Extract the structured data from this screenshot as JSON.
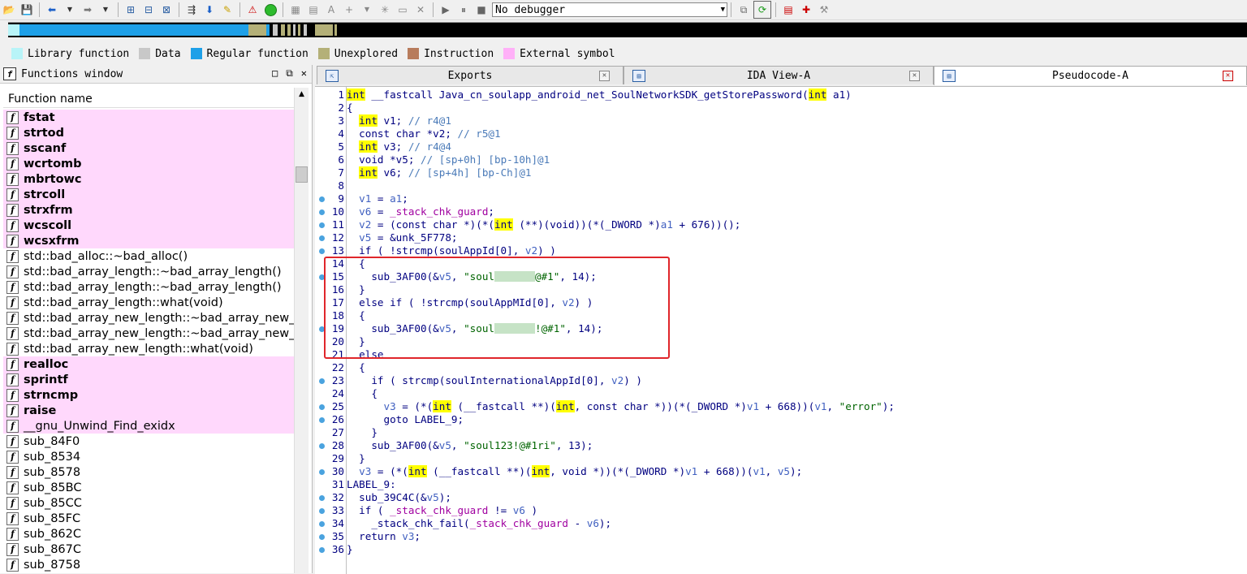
{
  "toolbar": {
    "debugger_select": "No debugger"
  },
  "legend": [
    {
      "label": "Library function",
      "color": "#b8f4f8"
    },
    {
      "label": "Data",
      "color": "#c8c8c8"
    },
    {
      "label": "Regular function",
      "color": "#1ea0e8"
    },
    {
      "label": "Unexplored",
      "color": "#b4b078"
    },
    {
      "label": "Instruction",
      "color": "#b87c5c"
    },
    {
      "label": "External symbol",
      "color": "#ffb0f8"
    }
  ],
  "functions_window": {
    "title": "Functions window",
    "column_header": "Function name",
    "rows": [
      {
        "name": "fstat",
        "lib": true
      },
      {
        "name": "strtod",
        "lib": true
      },
      {
        "name": "sscanf",
        "lib": true
      },
      {
        "name": "wcrtomb",
        "lib": true
      },
      {
        "name": "mbrtowc",
        "lib": true
      },
      {
        "name": "strcoll",
        "lib": true
      },
      {
        "name": "strxfrm",
        "lib": true
      },
      {
        "name": "wcscoll",
        "lib": true
      },
      {
        "name": "wcsxfrm",
        "lib": true
      },
      {
        "name": "std::bad_alloc::~bad_alloc()",
        "lib": false
      },
      {
        "name": "std::bad_array_length::~bad_array_length()",
        "lib": false
      },
      {
        "name": "std::bad_array_length::~bad_array_length()",
        "lib": false
      },
      {
        "name": "std::bad_array_length::what(void)",
        "lib": false
      },
      {
        "name": "std::bad_array_new_length::~bad_array_new_l",
        "lib": false
      },
      {
        "name": "std::bad_array_new_length::~bad_array_new_l",
        "lib": false
      },
      {
        "name": "std::bad_array_new_length::what(void)",
        "lib": false
      },
      {
        "name": "realloc",
        "lib": true
      },
      {
        "name": "sprintf",
        "lib": true
      },
      {
        "name": "strncmp",
        "lib": true
      },
      {
        "name": "raise",
        "lib": true
      },
      {
        "name": "__gnu_Unwind_Find_exidx",
        "lib": true,
        "light": true
      },
      {
        "name": "sub_84F0",
        "lib": false
      },
      {
        "name": "sub_8534",
        "lib": false
      },
      {
        "name": "sub_8578",
        "lib": false
      },
      {
        "name": "sub_85BC",
        "lib": false
      },
      {
        "name": "sub_85CC",
        "lib": false
      },
      {
        "name": "sub_85FC",
        "lib": false
      },
      {
        "name": "sub_862C",
        "lib": false
      },
      {
        "name": "sub_867C",
        "lib": false
      },
      {
        "name": "sub_8758",
        "lib": false
      }
    ]
  },
  "tabs": [
    {
      "label": "Exports",
      "active": false
    },
    {
      "label": "IDA View-A",
      "active": false
    },
    {
      "label": "Pseudocode-A",
      "active": true
    }
  ],
  "code": [
    {
      "n": "1",
      "dot": false,
      "html": "<span class=\"kw\">int</span> __fastcall Java_cn_soulapp_android_net_SoulNetworkSDK_getStorePassword(<span class=\"kw\">int</span> a1)"
    },
    {
      "n": "2",
      "dot": false,
      "html": "{"
    },
    {
      "n": "3",
      "dot": false,
      "html": "  <span class=\"kw\">int</span> v1; <span class=\"cm\">// r4@1</span>"
    },
    {
      "n": "4",
      "dot": false,
      "html": "  const char *v2; <span class=\"cm\">// r5@1</span>"
    },
    {
      "n": "5",
      "dot": false,
      "html": "  <span class=\"kw\">int</span> v3; <span class=\"cm\">// r4@4</span>"
    },
    {
      "n": "6",
      "dot": false,
      "html": "  void *v5; <span class=\"cm\">// [sp+0h] [bp-10h]@1</span>"
    },
    {
      "n": "7",
      "dot": false,
      "html": "  <span class=\"kw\">int</span> v6; <span class=\"cm\">// [sp+4h] [bp-Ch]@1</span>"
    },
    {
      "n": "8",
      "dot": false,
      "html": ""
    },
    {
      "n": "9",
      "dot": true,
      "html": "  <span class=\"vr\">v1</span> = <span class=\"vr\">a1</span>;"
    },
    {
      "n": "10",
      "dot": true,
      "html": "  <span class=\"vr\">v6</span> = <span class=\"gl\">_stack_chk_guard</span>;"
    },
    {
      "n": "11",
      "dot": true,
      "html": "  <span class=\"vr\">v2</span> = (const char *)(*(<span class=\"kw\">int</span> (**)(void))(*(_DWORD *)<span class=\"vr\">a1</span> + 676))();"
    },
    {
      "n": "12",
      "dot": true,
      "html": "  <span class=\"vr\">v5</span> = &amp;unk_5F778;"
    },
    {
      "n": "13",
      "dot": true,
      "html": "  if ( !strcmp(soulAppId[0], <span class=\"vr\">v2</span>) )"
    },
    {
      "n": "14",
      "dot": false,
      "html": "  {"
    },
    {
      "n": "15",
      "dot": true,
      "html": "    sub_3AF00(&amp;<span class=\"vr\">v5</span>, <span class=\"str\">\"soul<span class=\"blur\"></span>@#1\"</span>, 14);"
    },
    {
      "n": "16",
      "dot": false,
      "html": "  }"
    },
    {
      "n": "17",
      "dot": false,
      "html": "  else if ( !strcmp(soulAppMId[0], <span class=\"vr\">v2</span>) )"
    },
    {
      "n": "18",
      "dot": false,
      "html": "  {"
    },
    {
      "n": "19",
      "dot": true,
      "html": "    sub_3AF00(&amp;<span class=\"vr\">v5</span>, <span class=\"str\">\"soul<span class=\"blur\"></span>!@#1\"</span>, 14);"
    },
    {
      "n": "20",
      "dot": false,
      "html": "  }"
    },
    {
      "n": "21",
      "dot": false,
      "html": "  else"
    },
    {
      "n": "22",
      "dot": false,
      "html": "  {"
    },
    {
      "n": "23",
      "dot": true,
      "html": "    if ( strcmp(soulInternationalAppId[0], <span class=\"vr\">v2</span>) )"
    },
    {
      "n": "24",
      "dot": false,
      "html": "    {"
    },
    {
      "n": "25",
      "dot": true,
      "html": "      <span class=\"vr\">v3</span> = (*(<span class=\"kw\">int</span> (__fastcall **)(<span class=\"kw\">int</span>, const char *))(*(_DWORD *)<span class=\"vr\">v1</span> + 668))(<span class=\"vr\">v1</span>, <span class=\"str\">\"error\"</span>);"
    },
    {
      "n": "26",
      "dot": true,
      "html": "      goto LABEL_9;"
    },
    {
      "n": "27",
      "dot": false,
      "html": "    }"
    },
    {
      "n": "28",
      "dot": true,
      "html": "    sub_3AF00(&amp;<span class=\"vr\">v5</span>, <span class=\"str\">\"soul123!@#1ri\"</span>, 13);"
    },
    {
      "n": "29",
      "dot": false,
      "html": "  }"
    },
    {
      "n": "30",
      "dot": true,
      "html": "  <span class=\"vr\">v3</span> = (*(<span class=\"kw\">int</span> (__fastcall **)(<span class=\"kw\">int</span>, void *))(*(_DWORD *)<span class=\"vr\">v1</span> + 668))(<span class=\"vr\">v1</span>, <span class=\"vr\">v5</span>);"
    },
    {
      "n": "31",
      "dot": false,
      "html": "LABEL_9:"
    },
    {
      "n": "32",
      "dot": true,
      "html": "  sub_39C4C(&amp;<span class=\"vr\">v5</span>);"
    },
    {
      "n": "33",
      "dot": true,
      "html": "  if ( <span class=\"gl\">_stack_chk_guard</span> != <span class=\"vr\">v6</span> )"
    },
    {
      "n": "34",
      "dot": true,
      "html": "    _stack_chk_fail(<span class=\"gl\">_stack_chk_guard</span> - <span class=\"vr\">v6</span>);"
    },
    {
      "n": "35",
      "dot": true,
      "html": "  return <span class=\"vr\">v3</span>;"
    },
    {
      "n": "36",
      "dot": true,
      "html": "}"
    }
  ]
}
